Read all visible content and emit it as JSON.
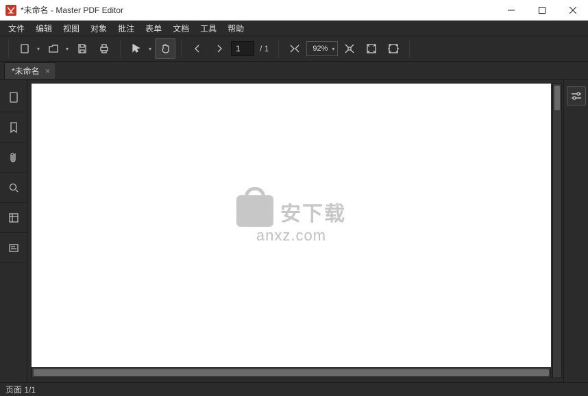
{
  "window": {
    "title": "*未命名 - Master PDF Editor"
  },
  "menu": {
    "items": [
      "文件",
      "编辑",
      "视图",
      "对象",
      "批注",
      "表单",
      "文档",
      "工具",
      "帮助"
    ]
  },
  "toolbar": {
    "page_current": "1",
    "page_total": "/ 1",
    "zoom": "92%"
  },
  "tabs": [
    {
      "label": "*未命名"
    }
  ],
  "status": {
    "page": "页面 1/1"
  },
  "watermark": {
    "cn": "安下载",
    "en": "anxz.com"
  }
}
